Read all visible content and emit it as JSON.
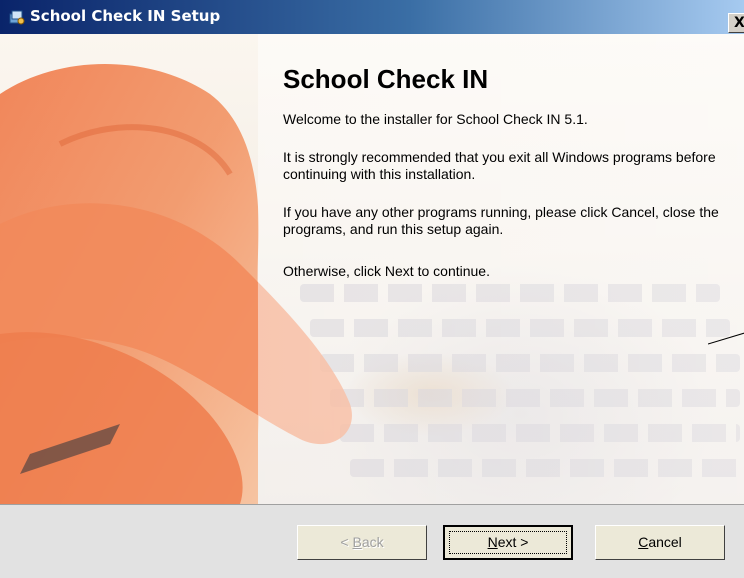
{
  "window": {
    "title": "School Check IN Setup",
    "close_label": "X"
  },
  "welcome": {
    "heading": "School Check IN",
    "paragraphs": [
      "Welcome to the installer for School Check IN 5.1.",
      "It is strongly recommended that you exit all Windows programs before continuing with this installation.",
      "If you have any other programs running, please click Cancel, close the programs, and run this setup again.",
      "Otherwise, click Next to continue."
    ]
  },
  "buttons": {
    "back": {
      "prefix": "< ",
      "hotkey": "B",
      "rest": "ack"
    },
    "next": {
      "hotkey": "N",
      "rest": "ext >"
    },
    "cancel": {
      "hotkey": "C",
      "rest": "ancel"
    }
  },
  "icons": {
    "title_icon": "setup-installer-icon",
    "close_icon": "close-icon"
  },
  "colors": {
    "titlebar_start": "#0a246a",
    "titlebar_end": "#a6caf0",
    "dialog_face": "#ece9d8"
  }
}
